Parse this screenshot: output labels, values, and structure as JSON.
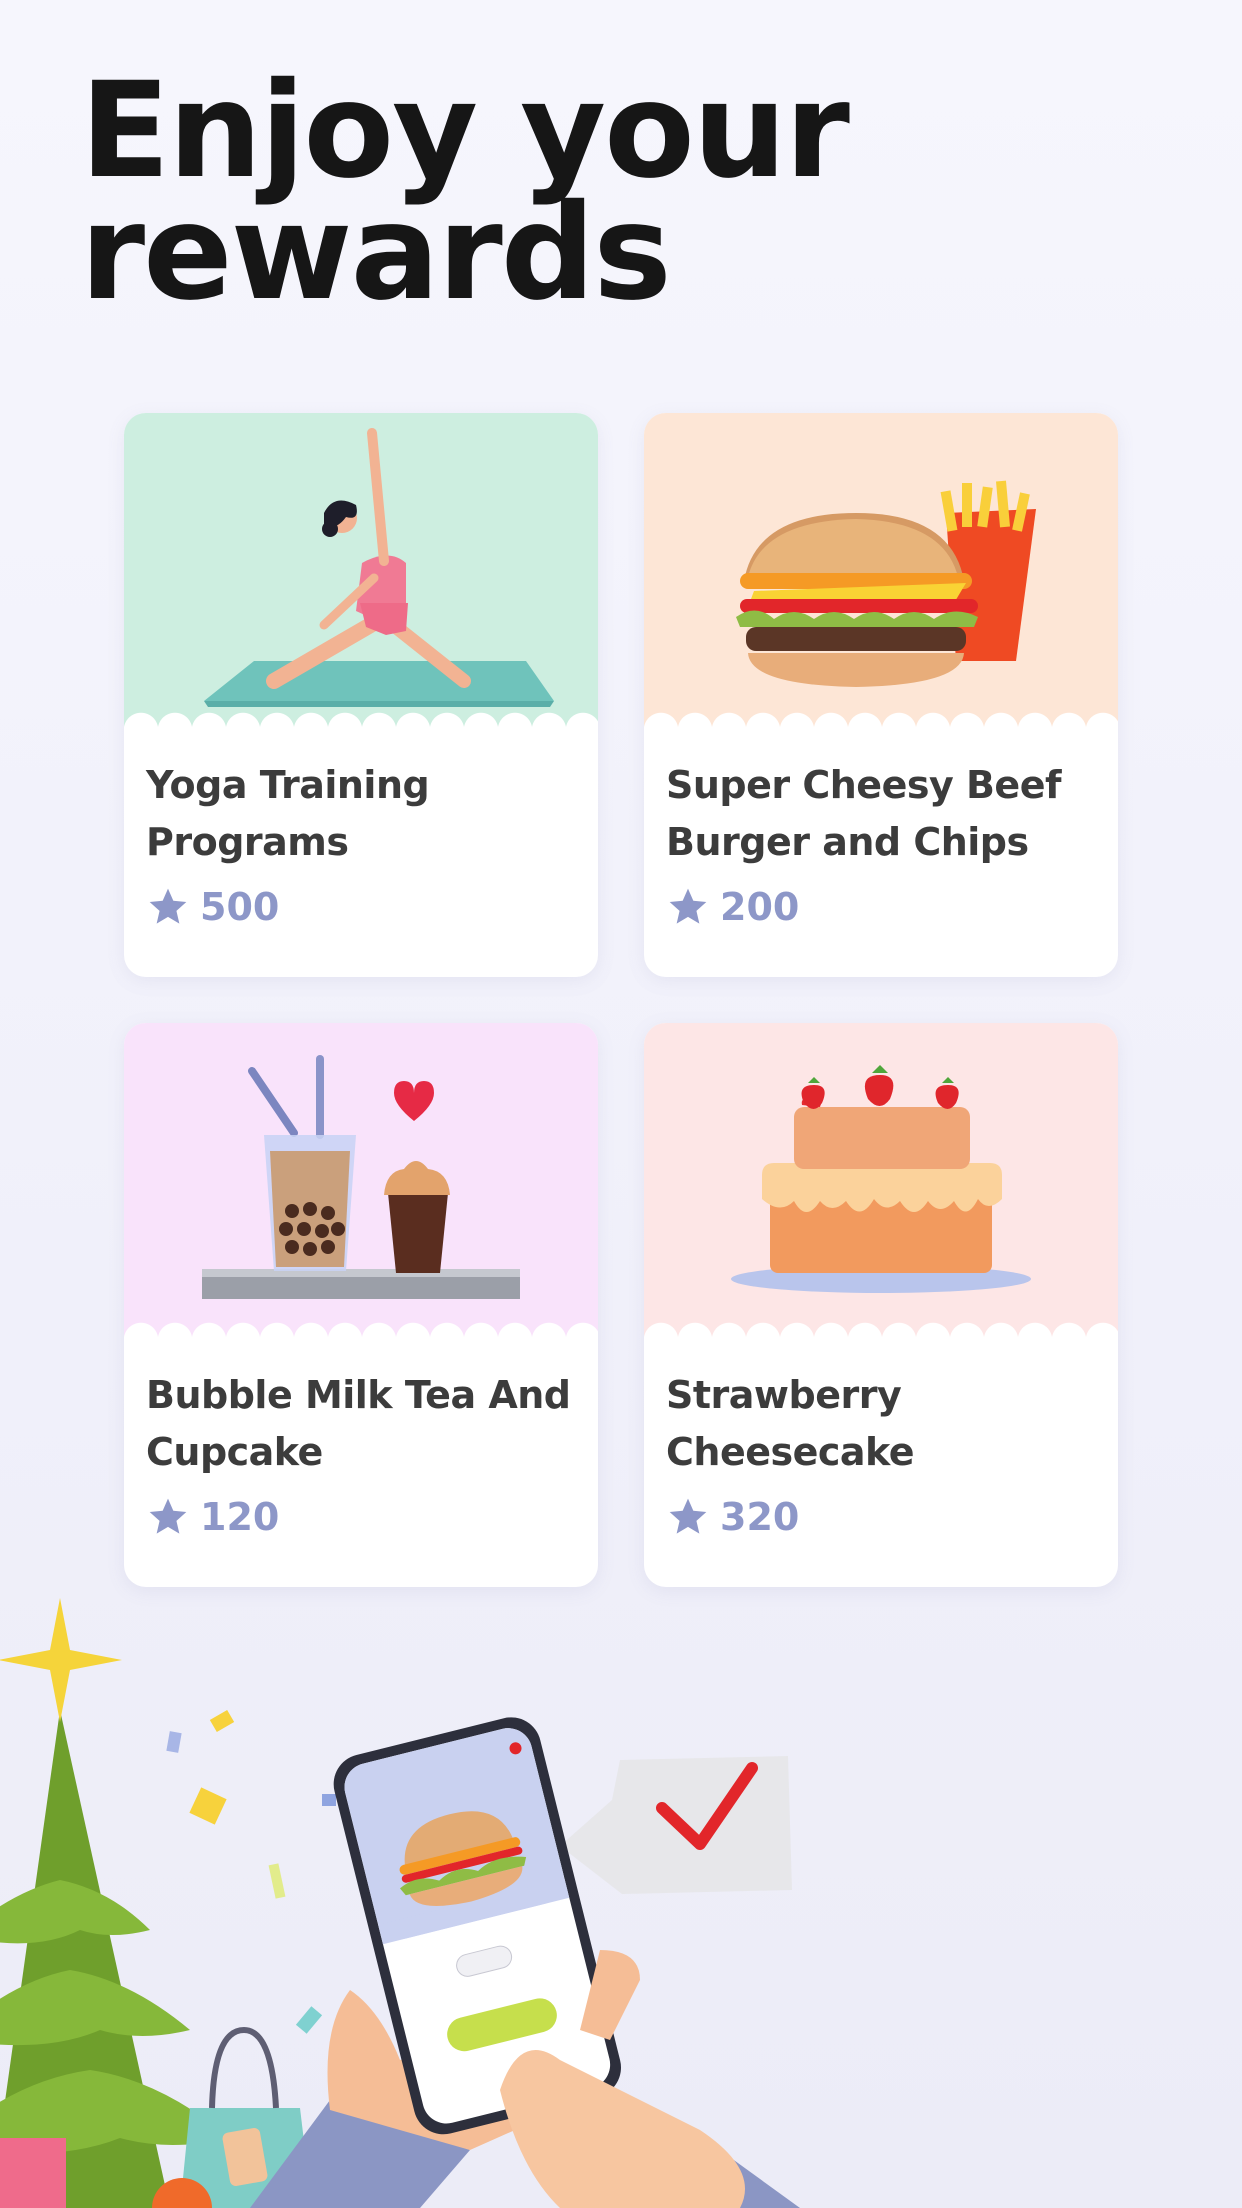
{
  "headline": {
    "line1": "Enjoy your",
    "line2": "rewards"
  },
  "colors": {
    "background": "#f4f4fc",
    "headline": "#161616",
    "card_title": "#3c3c3c",
    "points": "#8d97c8"
  },
  "rewards": [
    {
      "title": "Yoga Training Programs",
      "points": "500",
      "image": "yoga-woman-on-mat",
      "bg": "#cdeee0"
    },
    {
      "title": "Super Cheesy Beef Burger and Chips",
      "points": "200",
      "image": "burger-and-fries",
      "bg": "#fde6d6"
    },
    {
      "title": "Bubble Milk Tea And Cupcake",
      "points": "120",
      "image": "bubble-tea-cupcake",
      "bg": "#f9e3fb"
    },
    {
      "title": "Strawberry Cheesecake",
      "points": "320",
      "image": "strawberry-cake",
      "bg": "#fde6e6"
    }
  ],
  "icons": {
    "points": "star-icon"
  }
}
